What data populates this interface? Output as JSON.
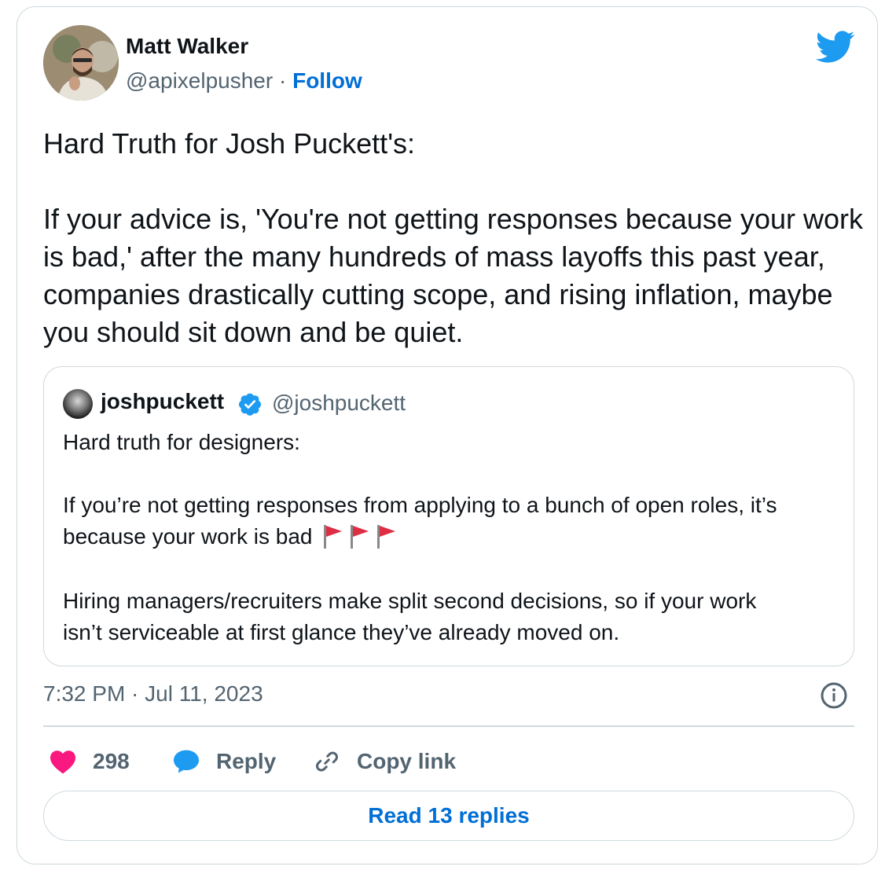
{
  "author": {
    "name": "Matt Walker",
    "handle": "@apixelpusher",
    "separator": "·",
    "follow_label": "Follow"
  },
  "tweet": {
    "text": "Hard Truth for Josh Puckett's:\n\nIf your advice is, 'You're not getting responses because your work is bad,' after the many hundreds of mass layoffs this past year, companies drastically cutting scope, and rising inflation, maybe you should sit down and be quiet.",
    "timestamp": "7:32 PM · Jul 11, 2023"
  },
  "quoted": {
    "name": "joshpuckett",
    "handle": "@joshpuckett",
    "verified": true,
    "line1": "Hard truth for designers:",
    "line2a": "If you’re not getting responses from applying to a bunch of open roles, it’s",
    "line2b": "because your work is bad",
    "line3a": "Hiring managers/recruiters make split second decisions, so if your work",
    "line3b": "isn’t serviceable at first glance they’ve already moved on.",
    "emoji": "red-flag x3"
  },
  "actions": {
    "like_count": "298",
    "reply_label": "Reply",
    "copy_label": "Copy link"
  },
  "replies_button": "Read 13 replies",
  "colors": {
    "link": "#006fd6",
    "twitter_blue": "#1d9bf0",
    "like": "#f91880",
    "muted": "#536471",
    "border": "#cfd9de"
  }
}
